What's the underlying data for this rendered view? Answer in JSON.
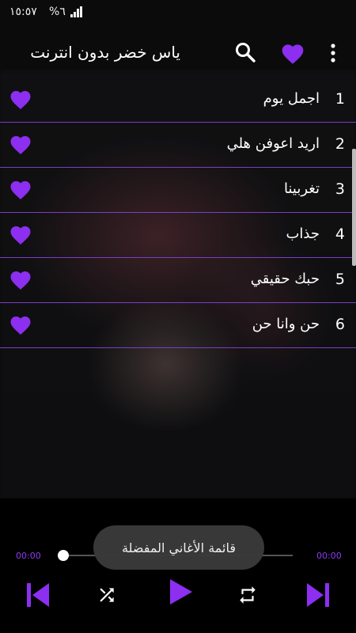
{
  "status": {
    "time": "١٥:٥٧",
    "battery": "%٦",
    "signal_icon": "signal-icon"
  },
  "appbar": {
    "title": "ياس خضر بدون انترنت",
    "icons": [
      "search-icon",
      "heart-icon",
      "more-vert-icon"
    ]
  },
  "songs": [
    {
      "number": "1",
      "title": "اجمل يوم",
      "favorite": true
    },
    {
      "number": "2",
      "title": "اريد اعوفن هلي",
      "favorite": true
    },
    {
      "number": "3",
      "title": "تغربينا",
      "favorite": true
    },
    {
      "number": "4",
      "title": "جذاب",
      "favorite": true
    },
    {
      "number": "5",
      "title": "حبك حقيقي",
      "favorite": true
    },
    {
      "number": "6",
      "title": "حن وانا حن",
      "favorite": true
    }
  ],
  "player": {
    "elapsed": "00:00",
    "duration": "00:00",
    "progress": 0,
    "controls": [
      "skip-previous-icon",
      "shuffle-icon",
      "play-icon",
      "repeat-icon",
      "skip-next-icon"
    ]
  },
  "toast": {
    "message": "قائمة الأغاني المفضلة"
  },
  "colors": {
    "accent": "#8c2ff0",
    "divider": "#7a3fc4",
    "text": "#ffffff"
  }
}
